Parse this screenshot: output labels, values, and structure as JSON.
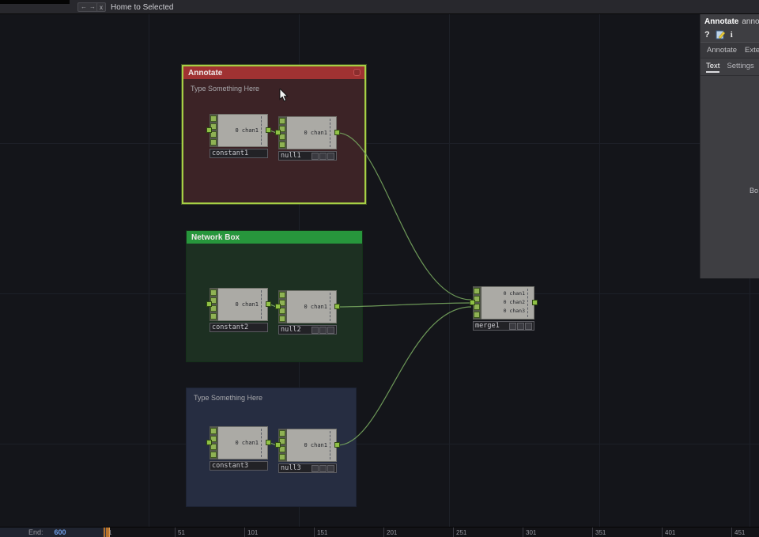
{
  "topbar": {
    "nav_back": "←",
    "nav_fwd": "→",
    "close": "x",
    "title": "Home to Selected"
  },
  "annotate_box": {
    "title": "Annotate",
    "note": "Type Something Here"
  },
  "network_box": {
    "title": "Network Box"
  },
  "blue_box": {
    "note": "Type Something Here"
  },
  "nodes": {
    "constant1": {
      "name": "constant1",
      "ch": "0 chan1"
    },
    "null1": {
      "name": "null1",
      "ch": "0 chan1"
    },
    "constant2": {
      "name": "constant2",
      "ch": "0 chan1"
    },
    "null2": {
      "name": "null2",
      "ch": "0 chan1"
    },
    "constant3": {
      "name": "constant3",
      "ch": "0 chan1"
    },
    "null3": {
      "name": "null3",
      "ch": "0 chan1"
    },
    "merge1": {
      "name": "merge1",
      "ch1": "0 chan1",
      "ch2": "0 chan2",
      "ch3": "0 chan3"
    }
  },
  "panel": {
    "title": "Annotate",
    "title2": "annot",
    "help": "?",
    "info": "i",
    "tab1": "Annotate",
    "tab2": "Exter",
    "subtab1": "Text",
    "subtab2": "Settings",
    "clipped": "Bo"
  },
  "timeline": {
    "end_label": "End:",
    "end_value": "600",
    "ticks": [
      "1",
      "51",
      "101",
      "151",
      "201",
      "251",
      "301",
      "351",
      "401",
      "451"
    ]
  },
  "colors": {
    "selection": "#a6cf45",
    "annotate_header": "#a03232",
    "network_header": "#27963c",
    "wire": "#76a55e",
    "accent_blue": "#6f9ee8"
  }
}
